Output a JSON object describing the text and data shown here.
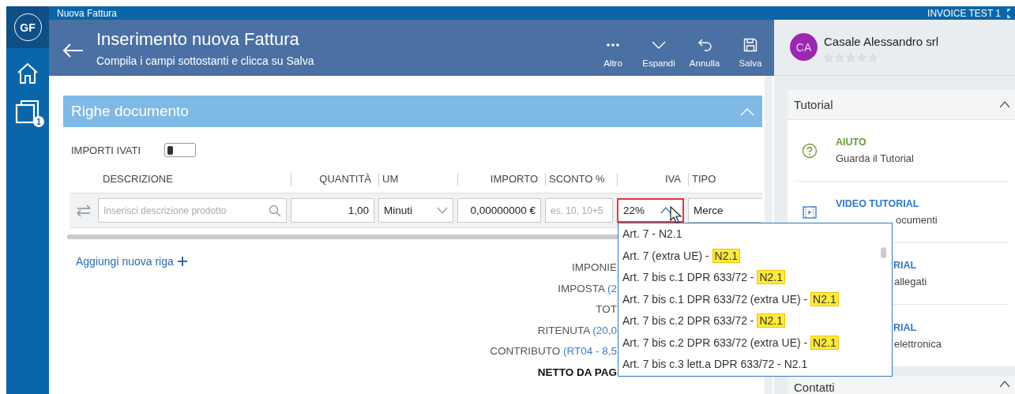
{
  "topbar": {
    "title": "Nuova Fattura",
    "workspace": "INVOICE TEST 1"
  },
  "sidebar": {
    "user_initials": "GF",
    "items": [
      {
        "kind": "home"
      },
      {
        "kind": "documents",
        "badge": "1"
      }
    ]
  },
  "header": {
    "title": "Inserimento nuova Fattura",
    "subtitle": "Compila i campi sottostanti e clicca su Salva",
    "actions": [
      {
        "kind": "more",
        "label": "Altro"
      },
      {
        "kind": "expand",
        "label": "Espandi"
      },
      {
        "kind": "undo",
        "label": "Annulla"
      },
      {
        "kind": "save",
        "label": "Salva"
      }
    ]
  },
  "section": {
    "title": "Righe documento",
    "expanded": true
  },
  "vat_toggle": {
    "label": "IMPORTI IVATI",
    "on": false
  },
  "table": {
    "columns": [
      "DESCRIZIONE",
      "QUANTITÀ",
      "UM",
      "IMPORTO",
      "SCONTO %",
      "IVA",
      "TIPO"
    ],
    "row": {
      "description_placeholder": "Inserisci descrizione prodotto",
      "quantity": "1,00",
      "unit": "Minuti",
      "amount": "0,00000000 €",
      "discount_placeholder": "es. 10, 10+5",
      "vat": "22%",
      "type": "Merce"
    }
  },
  "add_row": "Aggiungi nuova riga",
  "totals": [
    {
      "kind": "plain",
      "label": "IMPONIE"
    },
    {
      "kind": "plain",
      "label": "IMPOSTA ",
      "detail": "(2"
    },
    {
      "kind": "plain",
      "label": "TOT"
    },
    {
      "kind": "plain",
      "label": "RITENUTA ",
      "detail": "(20,0"
    },
    {
      "kind": "plain",
      "label": "CONTRIBUTO ",
      "detail": "(RT04 - 8,5"
    },
    {
      "kind": "net",
      "label": "NETTO DA PAG"
    }
  ],
  "vat_dropdown": {
    "open": true,
    "options": [
      {
        "text": "Art. 7 - ",
        "code": "N2.1",
        "highlighted": false
      },
      {
        "text": "Art. 7 (extra UE) - ",
        "code": "N2.1",
        "highlighted": true
      },
      {
        "text": "Art. 7 bis c.1 DPR 633/72 - ",
        "code": "N2.1",
        "highlighted": true
      },
      {
        "text": "Art. 7 bis c.1 DPR 633/72 (extra UE) - ",
        "code": "N2.1",
        "highlighted": true
      },
      {
        "text": "Art. 7 bis c.2 DPR 633/72 - ",
        "code": "N2.1",
        "highlighted": true
      },
      {
        "text": "Art. 7 bis c.2 DPR 633/72 (extra UE) - ",
        "code": "N2.1",
        "highlighted": true
      },
      {
        "text": "Art. 7 bis c.3 lett.a DPR 633/72 - ",
        "code": "N2.1",
        "highlighted": false
      }
    ]
  },
  "right_panel": {
    "contact": {
      "initials": "CA",
      "name": "Casale Alessandro srl",
      "stars": 0
    },
    "tutorial": {
      "title": "Tutorial",
      "expanded": true,
      "items": [
        {
          "kind": "help",
          "title": "AIUTO",
          "subtitle": "Guarda il Tutorial"
        },
        {
          "kind": "video",
          "title": "VIDEO TUTORIAL",
          "subtitle": "ocumenti"
        },
        {
          "kind": "video",
          "title": "RIAL",
          "subtitle": "allegati"
        },
        {
          "kind": "video",
          "title": "RIAL",
          "subtitle": "elettronica"
        }
      ]
    },
    "contacts": {
      "title": "Contatti",
      "expanded": true
    }
  }
}
